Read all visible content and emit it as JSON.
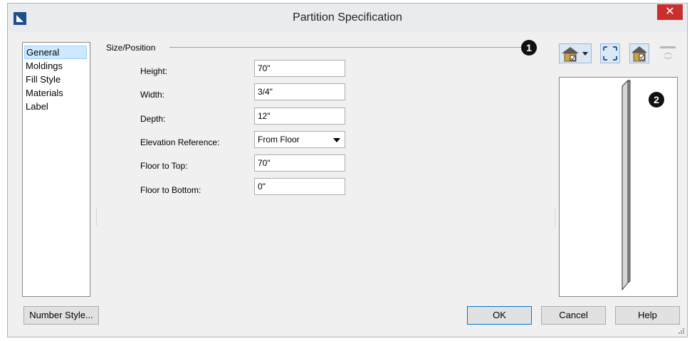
{
  "window": {
    "title": "Partition Specification",
    "close_symbol": "✕"
  },
  "nav": {
    "items": [
      {
        "label": "General",
        "selected": true
      },
      {
        "label": "Moldings"
      },
      {
        "label": "Fill Style"
      },
      {
        "label": "Materials"
      },
      {
        "label": "Label"
      }
    ]
  },
  "size_position": {
    "group_title": "Size/Position",
    "height": {
      "label": "Height:",
      "value": "70\""
    },
    "width": {
      "label": "Width:",
      "value": "3/4\""
    },
    "depth": {
      "label": "Depth:",
      "value": "12\""
    },
    "elevation_reference": {
      "label": "Elevation Reference:",
      "value": "From Floor"
    },
    "floor_to_top": {
      "label": "Floor to Top:",
      "value": "70\""
    },
    "floor_to_bottom": {
      "label": "Floor to Bottom:",
      "value": "0\""
    }
  },
  "callouts": {
    "one": "1",
    "two": "2"
  },
  "toolbar": {
    "icons": [
      "view-house-icon",
      "fill-window-icon",
      "camera-view-icon",
      "rotate-icon"
    ]
  },
  "buttons": {
    "number_style": "Number Style...",
    "ok": "OK",
    "cancel": "Cancel",
    "help": "Help"
  },
  "colors": {
    "close_button": "#c9302c",
    "nav_selected": "#cde8ff",
    "default_button_border": "#0078d7"
  }
}
